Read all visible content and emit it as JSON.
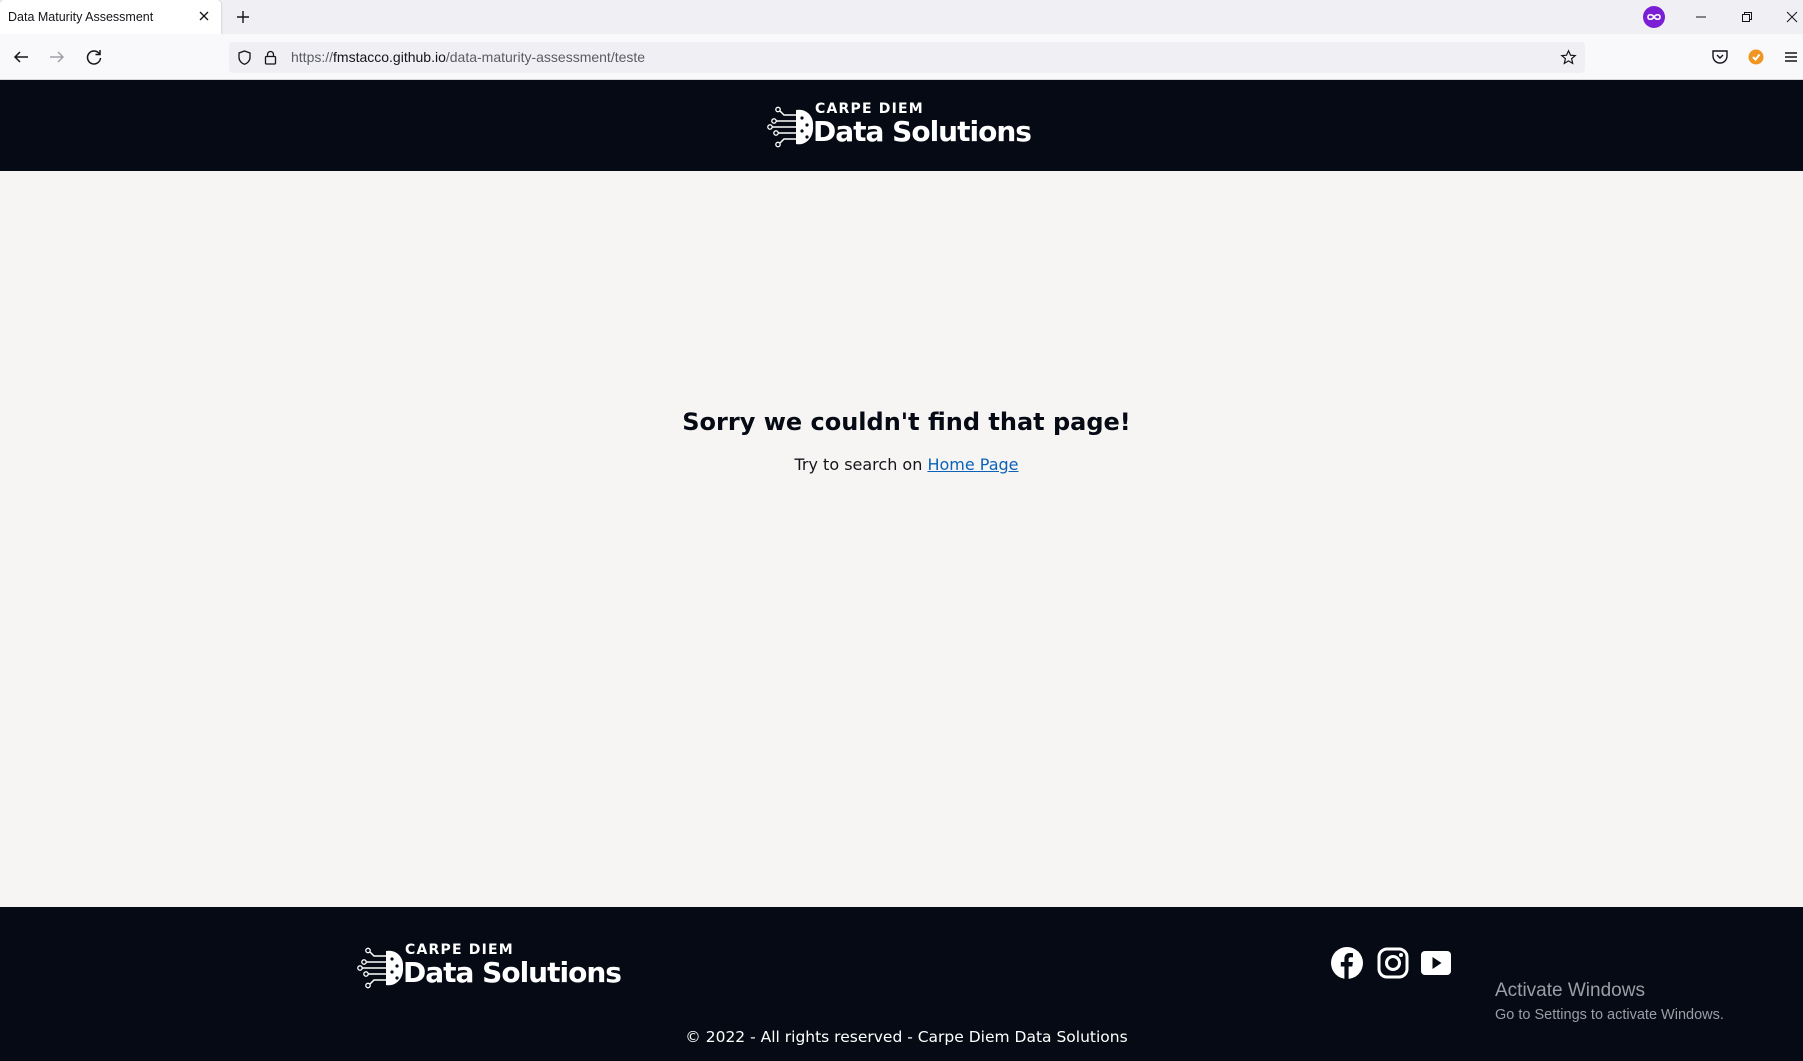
{
  "browser": {
    "tab_title": "Data Maturity Assessment",
    "url_prefix": "https://",
    "url_host": "fmstacco.github.io",
    "url_path": "/data-maturity-assessment/teste"
  },
  "header": {
    "logo_small": "CARPE DIEM",
    "logo_big": "Data Solutions"
  },
  "error": {
    "title": "Sorry we couldn't find that page!",
    "sub_text": "Try to search on ",
    "home_link": "Home Page"
  },
  "footer": {
    "logo_small": "CARPE DIEM",
    "logo_big": "Data Solutions",
    "copyright": "© 2022 - All rights reserved - Carpe Diem Data Solutions"
  },
  "watermark": {
    "title": "Activate Windows",
    "subtitle": "Go to Settings to activate Windows."
  },
  "colors": {
    "header_bg": "#050a14",
    "page_bg": "#f6f5f3",
    "link": "#0b62b8",
    "extension": "#7a1fd6"
  }
}
